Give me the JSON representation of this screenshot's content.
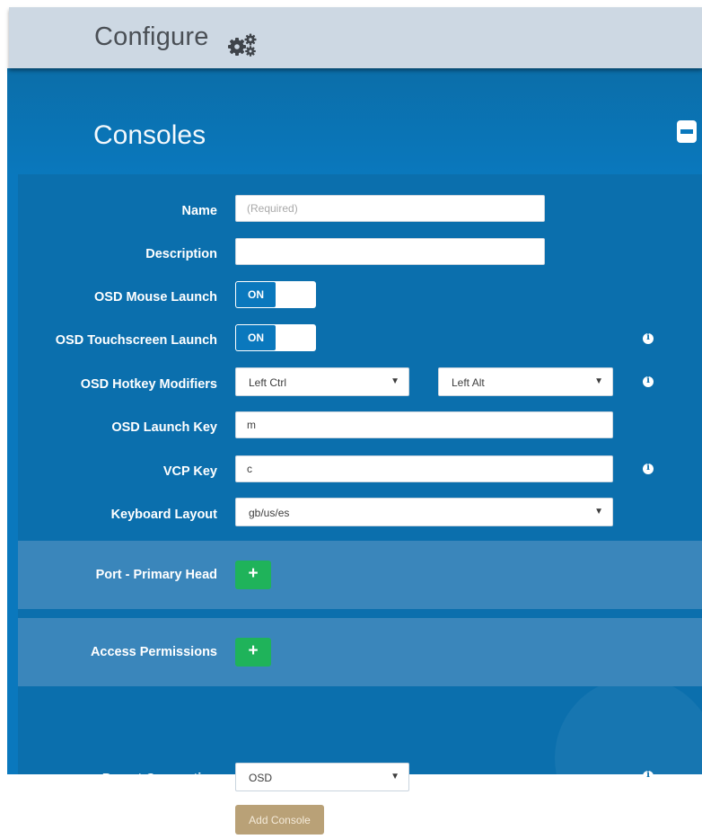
{
  "header": {
    "title": "Configure",
    "icon": "gears-icon"
  },
  "section": {
    "title": "Consoles",
    "collapse_icon": "minus-icon"
  },
  "form": {
    "name": {
      "label": "Name",
      "value": "",
      "placeholder": "(Required)"
    },
    "description": {
      "label": "Description",
      "value": "",
      "placeholder": ""
    },
    "osd_mouse_launch": {
      "label": "OSD Mouse Launch",
      "state": "ON"
    },
    "osd_touchscreen_launch": {
      "label": "OSD Touchscreen Launch",
      "state": "ON"
    },
    "osd_hotkey_modifiers": {
      "label": "OSD Hotkey Modifiers",
      "modifier1": "Left Ctrl",
      "modifier2": "Left Alt"
    },
    "osd_launch_key": {
      "label": "OSD Launch Key",
      "value": "m"
    },
    "vcp_key": {
      "label": "VCP Key",
      "value": "c"
    },
    "keyboard_layout": {
      "label": "Keyboard Layout",
      "value": "gb/us/es"
    },
    "port_primary_head": {
      "label": "Port - Primary Head",
      "button": "+"
    },
    "access_permissions": {
      "label": "Access Permissions",
      "button": "+"
    },
    "preset_connection": {
      "label": "Preset Connection",
      "value": "OSD"
    },
    "add_console": {
      "label": "Add Console"
    }
  },
  "colors": {
    "header_bg": "#cdd8e3",
    "main_bg": "#0a78bd",
    "panel_bg": "#0b6fad",
    "band_bg": "#3a86bb",
    "plus_green": "#1fb35a",
    "add_button": "#b9a177"
  }
}
